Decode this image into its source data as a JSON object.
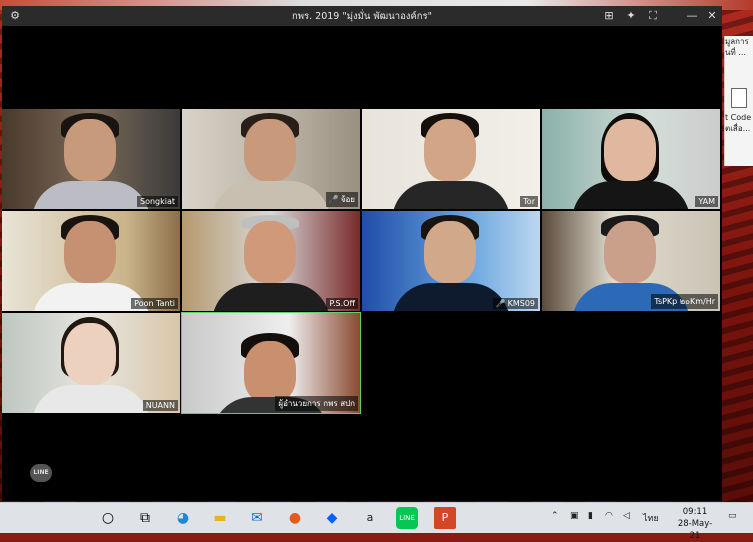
{
  "window": {
    "title": "กพร. 2019 \"มุ่งมั่น พัฒนาองค์กร\"",
    "settings_icon": "gear-icon",
    "controls": [
      "layout-icon",
      "pin-icon",
      "fullscreen-icon",
      "minimize-icon",
      "close-icon"
    ]
  },
  "participants": [
    {
      "name": "Songkiat",
      "muted": false
    },
    {
      "name": "จ้อย",
      "muted": true
    },
    {
      "name": "Tor",
      "muted": false
    },
    {
      "name": "YAM",
      "muted": false
    },
    {
      "name": "Poon Tanti",
      "muted": false
    },
    {
      "name": "P.S.Off",
      "muted": false
    },
    {
      "name": "KMS09",
      "muted": true
    },
    {
      "name": "TsPKp ๒๐Km/Hr",
      "muted": false
    },
    {
      "name": "NUANN",
      "muted": false
    },
    {
      "name": "ผู้อำนวยการ กพร สปก",
      "muted": false
    }
  ],
  "desktop_doc": {
    "lines": [
      "มูลการ",
      "ันที่ ...",
      "",
      "",
      "",
      "t Code",
      "ตเสื่อ..."
    ]
  },
  "watermark": "LINE",
  "taskbar": {
    "clock_time": "09:11",
    "clock_date": "28-May-21",
    "language": "ไทย",
    "apps": [
      "start-circle-icon",
      "task-view-icon",
      "edge-icon",
      "explorer-icon",
      "mail-icon",
      "firefox-icon",
      "dropbox-icon",
      "amazon-icon",
      "line-icon",
      "powerpoint-icon"
    ]
  }
}
